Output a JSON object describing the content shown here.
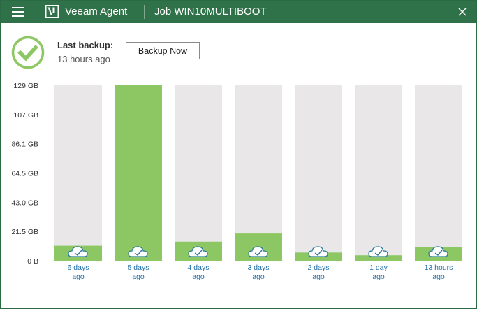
{
  "titlebar": {
    "app_title": "Veeam Agent",
    "job_title": "Job WIN10MULTIBOOT"
  },
  "status": {
    "label": "Last backup:",
    "time": "13 hours ago",
    "backup_now_label": "Backup Now"
  },
  "icons": {
    "menu": "hamburger-menu-icon",
    "logo": "veeam-logo-icon",
    "close": "close-icon",
    "status": "success-check-icon",
    "bar": "cloud-check-icon"
  },
  "colors": {
    "titlebar": "#2f7148",
    "bar_fill": "#8dc763",
    "bar_track": "#e9e7e7",
    "status_ring": "#8dc763",
    "link": "#1f6fa8"
  },
  "chart_data": {
    "type": "bar",
    "title": "",
    "xlabel": "",
    "ylabel": "",
    "y_tick_labels": [
      "0 B",
      "21.5 GB",
      "43.0 GB",
      "64.5 GB",
      "86.1 GB",
      "107 GB",
      "129 GB"
    ],
    "ylim": [
      0,
      129
    ],
    "unit": "GB",
    "grid": false,
    "categories": [
      "6 days ago",
      "5 days ago",
      "4 days ago",
      "3 days ago",
      "2 days ago",
      "1 day ago",
      "13 hours ago"
    ],
    "category_lines": [
      [
        "6 days",
        "ago"
      ],
      [
        "5 days",
        "ago"
      ],
      [
        "4 days",
        "ago"
      ],
      [
        "3 days",
        "ago"
      ],
      [
        "2 days",
        "ago"
      ],
      [
        "1 day",
        "ago"
      ],
      [
        "13 hours",
        "ago"
      ]
    ],
    "values": [
      11,
      129,
      14,
      20,
      6,
      4,
      10
    ]
  }
}
